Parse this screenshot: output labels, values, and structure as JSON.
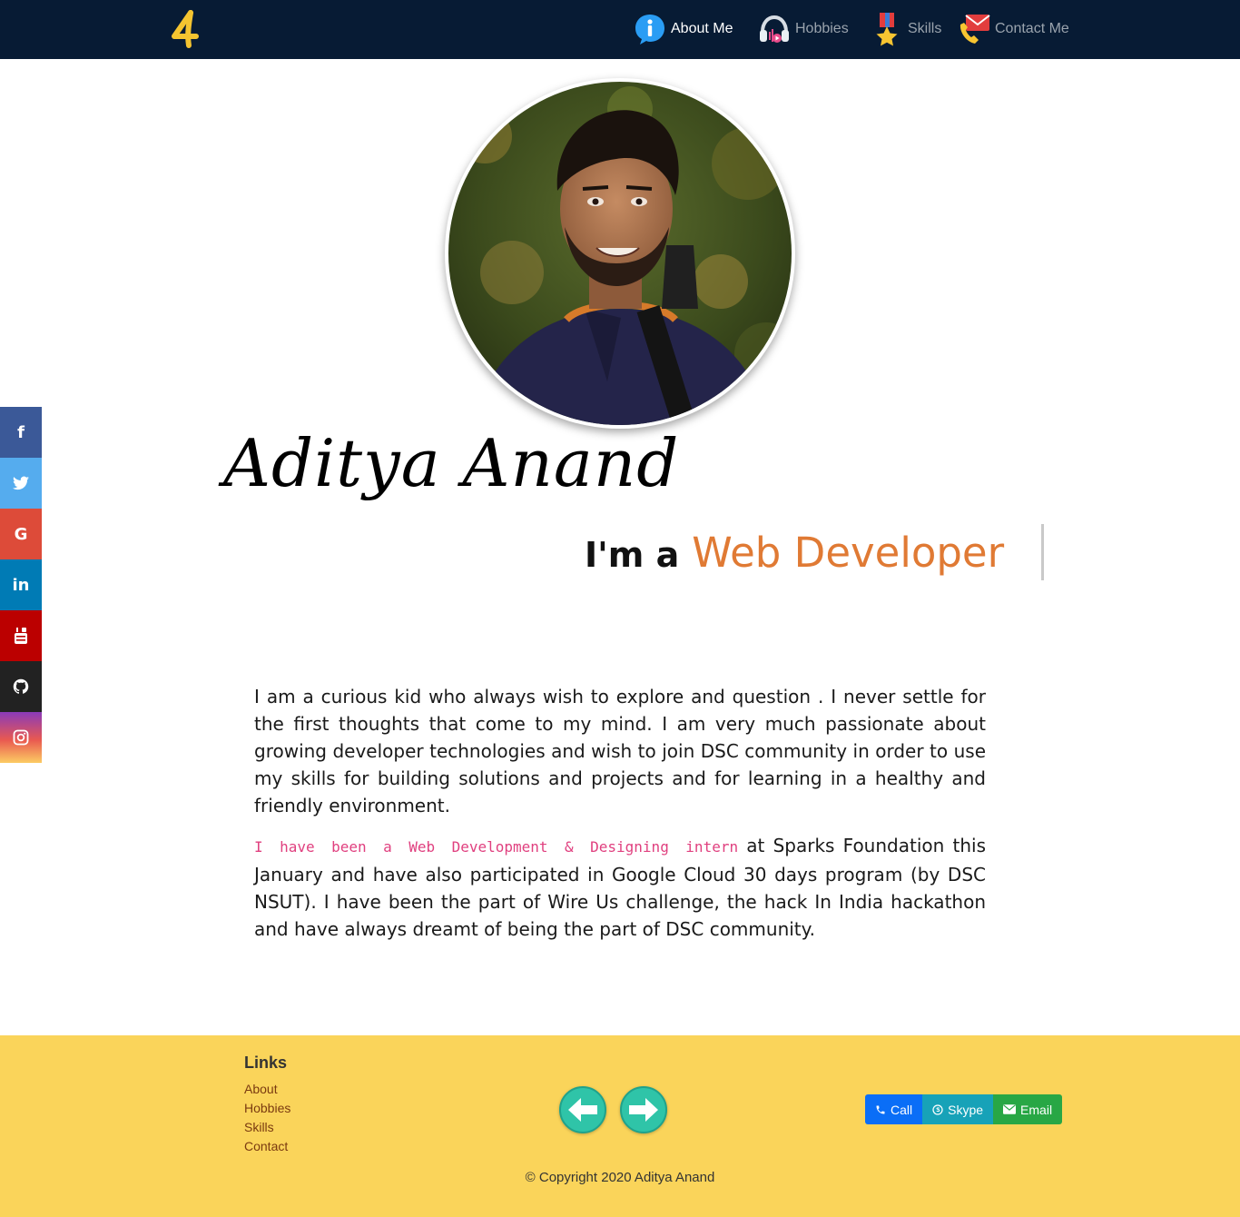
{
  "nav": {
    "brand_icon": "letter-4-logo-icon",
    "items": [
      {
        "label": "About Me",
        "icon": "info-icon",
        "active": true
      },
      {
        "label": "Hobbies",
        "icon": "headphones-icon",
        "active": false
      },
      {
        "label": "Skills",
        "icon": "medal-icon",
        "active": false
      },
      {
        "label": "Contact Me",
        "icon": "phone-envelope-icon",
        "active": false
      }
    ]
  },
  "profile": {
    "name": "Aditya Anand",
    "tagline_prefix": "I'm a",
    "tagline_role": "Web Developer"
  },
  "about": {
    "paragraph1": "I am a curious kid who always wish to explore and question . I never settle for the first thoughts that come to my mind. I am very much passionate about growing developer technologies and wish to join DSC community in order to use my skills for building solutions and projects and for learning in a healthy and friendly environment.",
    "paragraph2_highlight": "I have been a Web Development & Designing intern",
    "paragraph2_rest": " at Sparks Foundation this January and have also participated in Google Cloud 30 days program (by DSC NSUT). I have been the part of Wire Us challenge, the hack In India hackathon and have always dreamt of being the part of DSC community."
  },
  "social": {
    "facebook": "f",
    "google": "G",
    "linkedin": "in"
  },
  "footer": {
    "links_title": "Links",
    "links": [
      "About",
      "Hobbies",
      "Skills",
      "Contact"
    ],
    "buttons": {
      "call": "Call",
      "skype": "Skype",
      "email": "Email"
    },
    "copyright": "© Copyright 2020 Aditya Anand"
  },
  "colors": {
    "navbar": "#071b34",
    "accent_role": "#e07a34",
    "highlight_code": "#e0407f",
    "footer": "#fad45a"
  }
}
